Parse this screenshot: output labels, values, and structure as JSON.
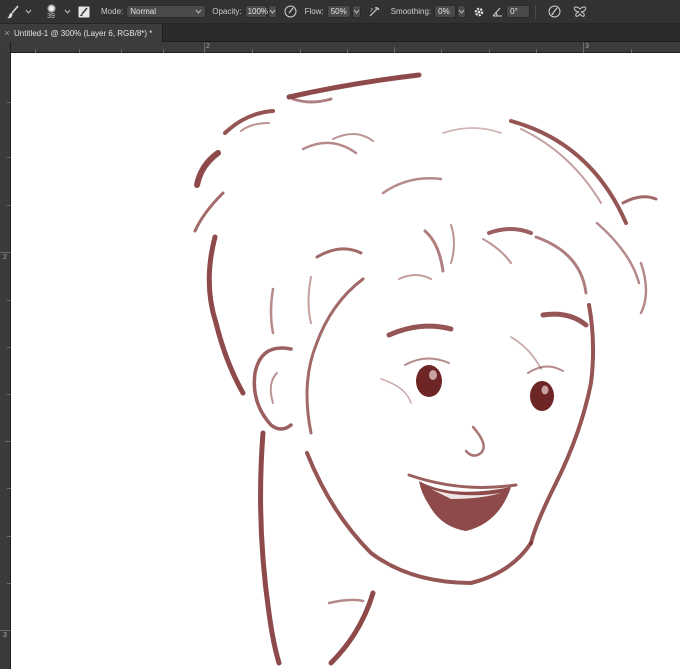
{
  "options_bar": {
    "brush_size": "39",
    "mode_label": "Mode:",
    "mode_value": "Normal",
    "opacity_label": "Opacity:",
    "opacity_value": "100%",
    "flow_label": "Flow:",
    "flow_value": "50%",
    "smoothing_label": "Smoothing:",
    "smoothing_value": "0%",
    "angle_value": "0°"
  },
  "document_tab": {
    "title": "Untitled-1 @ 300% (Layer 6, RGB/8*) *",
    "close_glyph": "×"
  },
  "rulers": {
    "top_marks": [
      "2",
      "3"
    ],
    "left_marks": [
      "2",
      "3"
    ]
  },
  "colors": {
    "stroke": "#7a2a2a",
    "canvas": "#ffffff",
    "chrome": "#323232"
  },
  "icons": {
    "tool": "brush-icon",
    "brush_preset": "brush-preset-icon",
    "brush_panel": "brush-settings-panel-icon",
    "pressure_opacity": "pressure-opacity-icon",
    "airbrush": "airbrush-icon",
    "smoothing_settings": "gear-icon",
    "angle": "angle-icon",
    "pressure_size": "pressure-size-icon",
    "symmetry": "butterfly-symmetry-icon"
  }
}
